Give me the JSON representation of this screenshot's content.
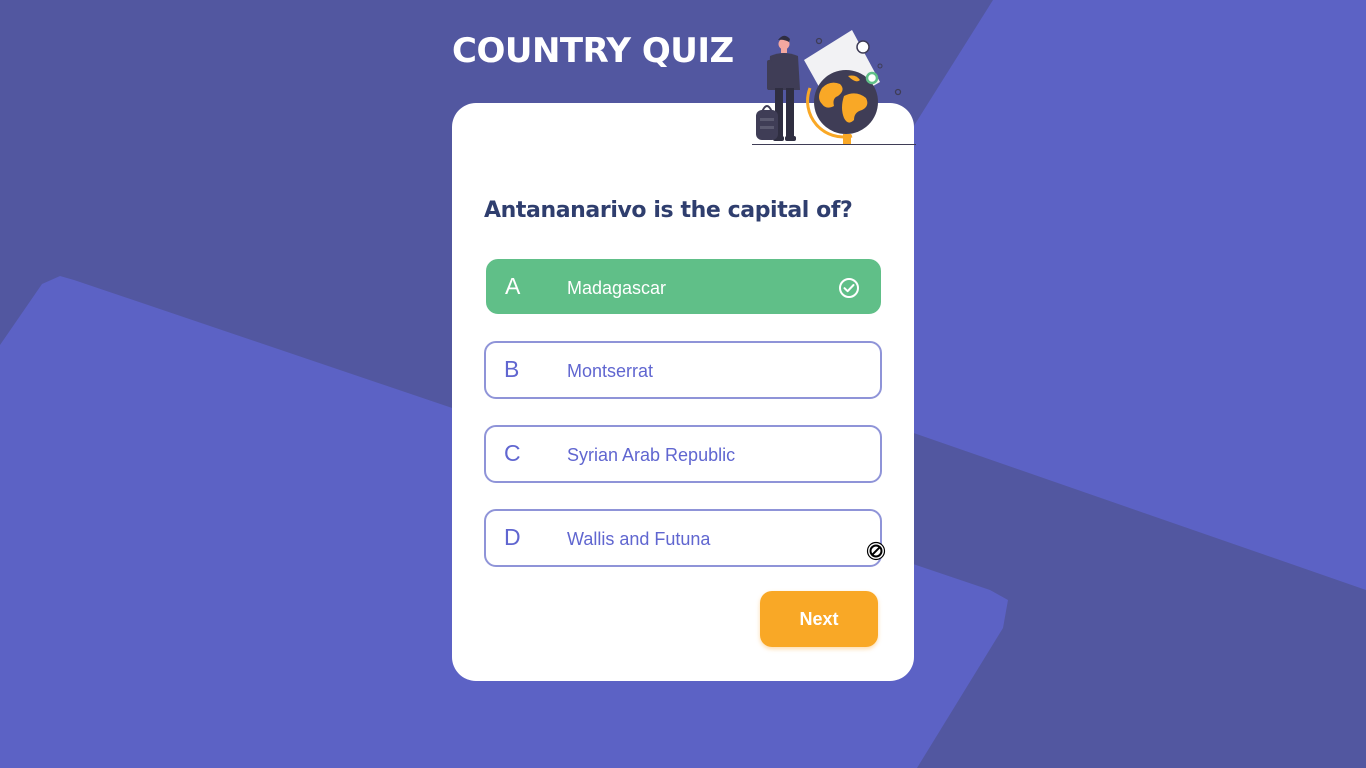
{
  "app": {
    "title": "COUNTRY QUIZ"
  },
  "question": {
    "text": "Antananarivo is the capital of?"
  },
  "options": [
    {
      "letter": "A",
      "text": "Madagascar",
      "state": "correct"
    },
    {
      "letter": "B",
      "text": "Montserrat",
      "state": "default"
    },
    {
      "letter": "C",
      "text": "Syrian Arab Republic",
      "state": "default"
    },
    {
      "letter": "D",
      "text": "Wallis and Futuna",
      "state": "default"
    }
  ],
  "actions": {
    "next_label": "Next"
  },
  "icons": {
    "correct": "check-circle-icon",
    "cursor": "not-allowed-cursor-icon"
  },
  "colors": {
    "background": "#5c62c5",
    "background_shade": "#5257a0",
    "card": "#ffffff",
    "title": "#ffffff",
    "question": "#2f3e6e",
    "option_border": "#8f94d8",
    "option_text": "#6066d0",
    "correct": "#60bf88",
    "next_button": "#f9a826"
  }
}
